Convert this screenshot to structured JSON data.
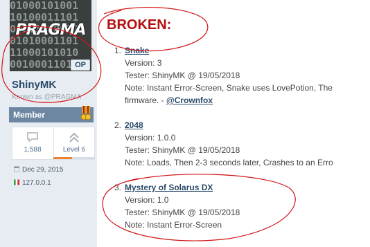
{
  "user": {
    "avatar_text": "PRAGMA",
    "op_badge": "OP",
    "username": "ShinyMK",
    "known_as": "Known as @PRAGMA",
    "rank": "Member",
    "messages": "1,588",
    "level": "Level 6",
    "level_progress": 0.45,
    "joined": "Dec 29, 2015",
    "ip": "127.0.0.1"
  },
  "post": {
    "heading": "BROKEN:",
    "items": [
      {
        "num": "1.",
        "title": "Snake",
        "version": "Version: 3",
        "tester": "Tester: ShinyMK @ 19/05/2018",
        "note": "Note: Instant Error-Screen, Snake uses LovePotion, The",
        "note2": "firmware. - ",
        "mention": "@Crownfox"
      },
      {
        "num": "2.",
        "title": "2048",
        "version": "Version: 1.0.0",
        "tester": "Tester: ShinyMK @ 19/05/2018",
        "note": "Note: Loads, Then 2-3 seconds later, Crashes to an Erro"
      },
      {
        "num": "3.",
        "title": "Mystery of Solarus DX",
        "version": "Version: 1.0",
        "tester": "Tester: ShinyMK @ 19/05/2018",
        "note": "Note: Instant Error-Screen"
      }
    ]
  },
  "colors": {
    "heading_red": "#b40f0f",
    "link_blue": "#2b4a6b",
    "annotation_red": "#d21414",
    "rank_bar": "#6d87a3"
  }
}
